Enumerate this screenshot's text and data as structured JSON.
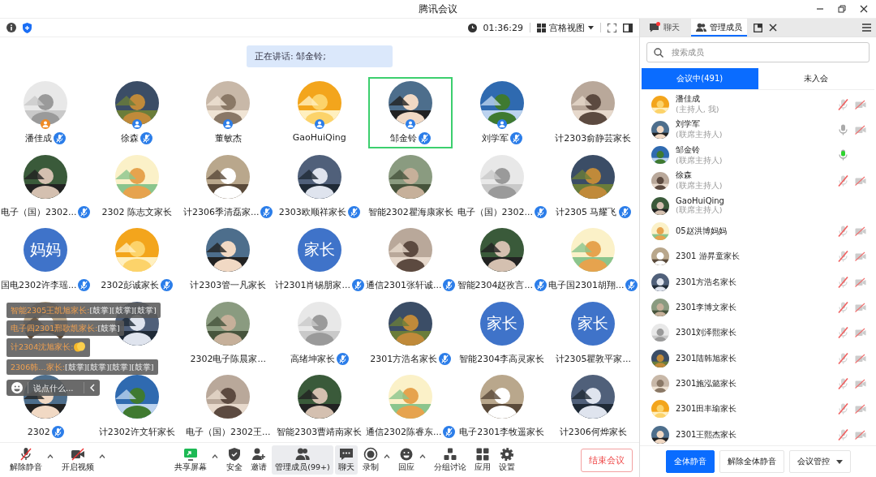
{
  "window": {
    "title": "腾讯会议"
  },
  "top_bar": {
    "timer": "01:36:29",
    "view_mode": "宫格视图"
  },
  "speaking_banner": "正在讲话: 邹金铃;",
  "tiles": [
    {
      "name": "潘佳成",
      "kind": "picture",
      "color": "#f08a24",
      "mic": true,
      "speaking": false
    },
    {
      "name": "徐森",
      "kind": "picture",
      "color": "#2b7de9",
      "mic": true,
      "speaking": false
    },
    {
      "name": "董敏杰",
      "kind": "picture",
      "color": "#2b7de9",
      "mic": false,
      "speaking": false
    },
    {
      "name": "GaoHuiQing",
      "kind": "picture",
      "color": "#2b7de9",
      "mic": false,
      "speaking": false
    },
    {
      "name": "邹金铃",
      "kind": "picture",
      "color": "#2b7de9",
      "mic": true,
      "speaking": true
    },
    {
      "name": "刘学军",
      "kind": "picture",
      "color": "#2b7de9",
      "mic": true,
      "speaking": false
    },
    {
      "name": "计2303俞静芸家长",
      "kind": "picture",
      "mic": false,
      "speaking": false
    },
    {
      "name": "电子（国）2302...",
      "kind": "picture",
      "mic": true,
      "speaking": false
    },
    {
      "name": "2302 陈志文家长",
      "kind": "picture",
      "mic": false,
      "speaking": false
    },
    {
      "name": "计2306季清磊家...",
      "kind": "picture",
      "mic": true,
      "speaking": false
    },
    {
      "name": "2303欧顺祥家长",
      "kind": "picture",
      "mic": true,
      "speaking": false
    },
    {
      "name": "智能2302瞿海康家长",
      "kind": "picture",
      "mic": false,
      "speaking": false
    },
    {
      "name": "电子（国）2302...",
      "kind": "picture",
      "mic": true,
      "speaking": false
    },
    {
      "name": "计2305 马耀飞",
      "kind": "picture",
      "mic": true,
      "speaking": false
    },
    {
      "name": "国电2302许李瑶...",
      "kind": "text",
      "avatar_text": "妈妈",
      "mic": true,
      "speaking": false
    },
    {
      "name": "2302彭诚家长",
      "kind": "picture",
      "mic": true,
      "speaking": false
    },
    {
      "name": "计2303管一凡家长",
      "kind": "picture",
      "mic": false,
      "speaking": false
    },
    {
      "name": "计2301肖锡朋家...",
      "kind": "text",
      "avatar_text": "家长",
      "mic": true,
      "speaking": false
    },
    {
      "name": "通信2301张轩诚...",
      "kind": "picture",
      "mic": true,
      "speaking": false
    },
    {
      "name": "智能2304赵孜言...",
      "kind": "picture",
      "mic": true,
      "speaking": false
    },
    {
      "name": "电子国2301胡翔...",
      "kind": "picture",
      "mic": true,
      "speaking": false
    },
    {
      "kind": "picture",
      "speaking": false
    },
    {
      "kind": "picture",
      "speaking": false
    },
    {
      "name": "2302电子陈晨家...",
      "kind": "picture",
      "mic": false,
      "speaking": false
    },
    {
      "name": "高绪坤家长",
      "kind": "picture",
      "mic": true,
      "speaking": false
    },
    {
      "name": "2301方浩名家长",
      "kind": "picture",
      "mic": true,
      "speaking": false
    },
    {
      "name": "智能2304李高灵家长",
      "kind": "text",
      "avatar_text": "家长",
      "mic": false,
      "speaking": false
    },
    {
      "name": "计2305瞿敦平家...",
      "kind": "text",
      "avatar_text": "家长",
      "mic": false,
      "speaking": false
    },
    {
      "name": "2302",
      "kind": "picture",
      "mic": true,
      "speaking": false
    },
    {
      "name": "计2302许文轩家长",
      "kind": "picture",
      "mic": false,
      "speaking": false
    },
    {
      "name": "电子（国）2302王...",
      "kind": "picture",
      "mic": false,
      "speaking": false
    },
    {
      "name": "智能2303曹靖南家长",
      "kind": "picture",
      "mic": false,
      "speaking": false
    },
    {
      "name": "通信2302陈睿东...",
      "kind": "picture",
      "mic": true,
      "speaking": false
    },
    {
      "name": "电子2301李牧遥家长",
      "kind": "picture",
      "mic": false,
      "speaking": false
    },
    {
      "name": "计2306何烨家长",
      "kind": "picture",
      "mic": false,
      "speaking": false
    }
  ],
  "chat_overlay": {
    "messages": [
      {
        "sender": "智能2305王凯旭家长:",
        "text": "[鼓掌][鼓掌][鼓掌]"
      },
      {
        "sender": "电子四2301邢歌凯家长:",
        "text": "[鼓掌]"
      },
      {
        "sender": "计2304沈旭家长:",
        "kind": "clap"
      },
      {
        "sender": "2306韩…家长:",
        "text": "[鼓掌][鼓掌][鼓掌][鼓掌]"
      }
    ],
    "placeholder": "说点什么..."
  },
  "toolbar": [
    {
      "label": "解除静音",
      "kind": "mic-off",
      "caret": true,
      "active": false
    },
    {
      "label": "开启视频",
      "kind": "video-off",
      "caret": true,
      "active": false
    },
    {
      "label": "共享屏幕",
      "kind": "share",
      "caret": true,
      "active": false
    },
    {
      "label": "安全",
      "kind": "shield",
      "caret": false,
      "active": false
    },
    {
      "label": "邀请",
      "kind": "invite",
      "caret": false,
      "active": false
    },
    {
      "label": "管理成员(99+)",
      "kind": "members",
      "caret": false,
      "active": true
    },
    {
      "label": "聊天",
      "kind": "chat",
      "caret": false,
      "active": true
    },
    {
      "label": "录制",
      "kind": "record",
      "caret": true,
      "active": false
    },
    {
      "label": "回应",
      "kind": "react",
      "caret": true,
      "active": false
    },
    {
      "label": "分组讨论",
      "kind": "groups",
      "caret": false,
      "active": false
    },
    {
      "label": "应用",
      "kind": "apps",
      "caret": false,
      "active": false
    },
    {
      "label": "设置",
      "kind": "settings",
      "caret": false,
      "active": false
    }
  ],
  "end_button": "结束会议",
  "side_panel": {
    "tabs": [
      {
        "label": "聊天",
        "selected": false,
        "unread": true
      },
      {
        "label": "管理成员",
        "selected": true,
        "unread": false
      }
    ],
    "search": {
      "placeholder": "搜索成员"
    },
    "segments": [
      {
        "label": "会议中(491)",
        "selected": true
      },
      {
        "label": "未入会",
        "selected": false
      }
    ],
    "members": [
      {
        "name": "潘佳成",
        "role": "(主持人, 我)",
        "mic_shown": true,
        "muted": true,
        "speaking": false,
        "camera_off": true
      },
      {
        "name": "刘学军",
        "role": "(联席主持人)",
        "mic_shown": true,
        "muted": false,
        "speaking": false,
        "camera_off": true
      },
      {
        "name": "邹金铃",
        "role": "(联席主持人)",
        "mic_shown": true,
        "muted": false,
        "speaking": true,
        "camera_off": false
      },
      {
        "name": "徐森",
        "role": "(联席主持人)",
        "mic_shown": true,
        "muted": true,
        "speaking": false,
        "camera_off": true
      },
      {
        "name": "GaoHuiQing",
        "role": "(联席主持人)",
        "mic_shown": false,
        "camera_off": false
      },
      {
        "name": "05赵洪博妈妈",
        "mic_shown": true,
        "muted": true,
        "speaking": false,
        "camera_off": true
      },
      {
        "name": "2301 游昇童家长",
        "mic_shown": true,
        "muted": true,
        "speaking": false,
        "camera_off": true
      },
      {
        "name": "2301方浩名家长",
        "mic_shown": true,
        "muted": true,
        "speaking": false,
        "camera_off": true
      },
      {
        "name": "2301李博文家长",
        "mic_shown": true,
        "muted": true,
        "speaking": false,
        "camera_off": true
      },
      {
        "name": "2301刘泽熙家长",
        "mic_shown": true,
        "muted": true,
        "speaking": false,
        "camera_off": true
      },
      {
        "name": "2301陆韩旭家长",
        "mic_shown": true,
        "muted": true,
        "speaking": false,
        "camera_off": true
      },
      {
        "name": "2301施泓懿家长",
        "mic_shown": true,
        "muted": true,
        "speaking": false,
        "camera_off": true
      },
      {
        "name": "2301田丰瑜家长",
        "mic_shown": true,
        "muted": true,
        "speaking": false,
        "camera_off": true
      },
      {
        "name": "2301王熙杰家长",
        "mic_shown": true,
        "muted": true,
        "speaking": false,
        "camera_off": true
      }
    ],
    "buttons": [
      {
        "label": "全体静音",
        "kind": "primary"
      },
      {
        "label": "解除全体静音",
        "kind": "plain"
      },
      {
        "label": "会议管控",
        "kind": "menu"
      }
    ]
  }
}
